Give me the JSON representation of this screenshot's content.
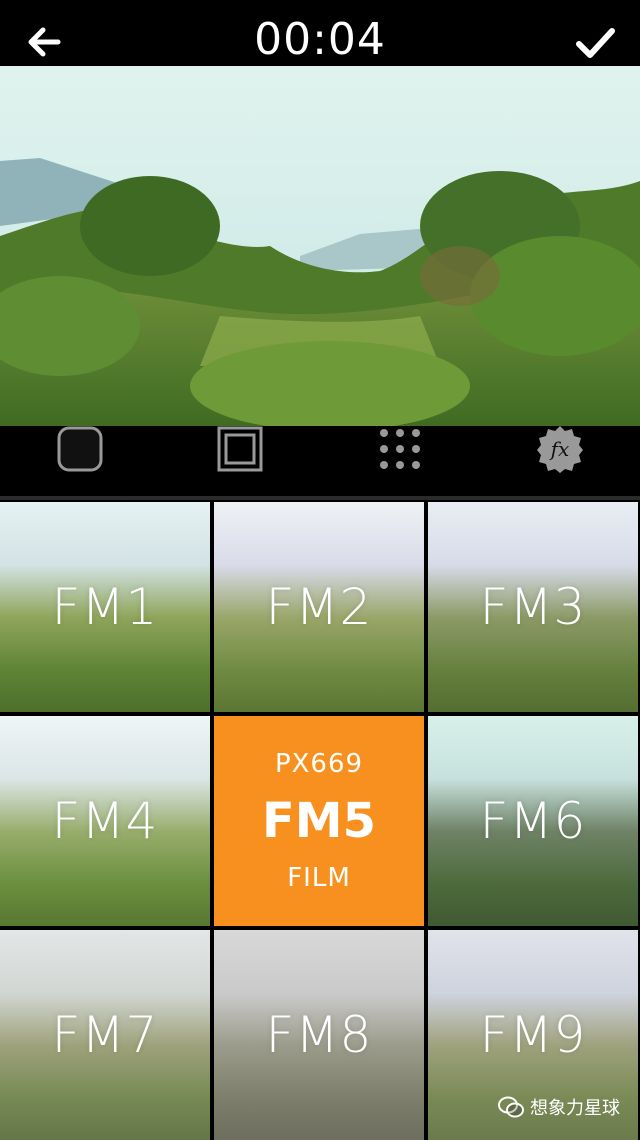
{
  "header": {
    "timer": "00:04"
  },
  "icons": {
    "back": "back-arrow-icon",
    "confirm": "checkmark-icon",
    "tools": [
      "rounded-frame-icon",
      "square-frame-icon",
      "dot-grid-icon",
      "fx-icon"
    ]
  },
  "tools": {
    "fx_label": "fx"
  },
  "filters": [
    {
      "label": "FM1"
    },
    {
      "label": "FM2"
    },
    {
      "label": "FM3"
    },
    {
      "label": "FM4"
    },
    {
      "label": "FM5",
      "selected": true,
      "top": "PX669",
      "bottom": "FILM"
    },
    {
      "label": "FM6"
    },
    {
      "label": "FM7"
    },
    {
      "label": "FM8"
    },
    {
      "label": "FM9"
    }
  ],
  "watermark": {
    "text": "想象力星球"
  },
  "colors": {
    "accent": "#F7901E",
    "background": "#000000"
  }
}
